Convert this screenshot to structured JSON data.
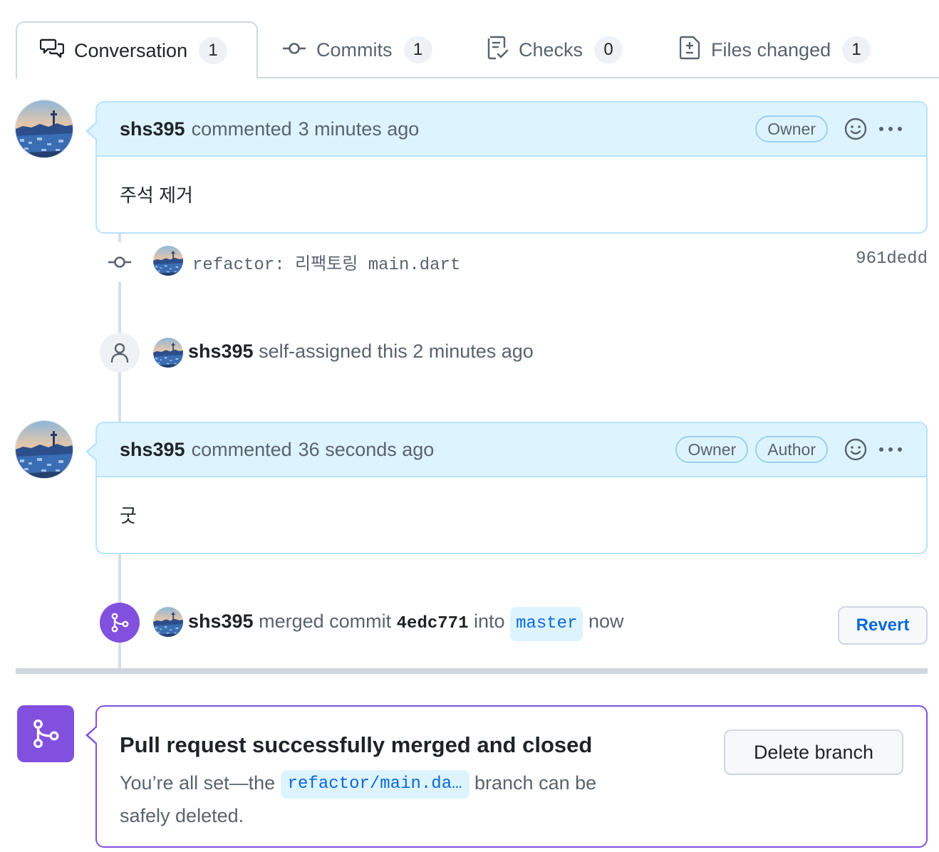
{
  "tabs": [
    {
      "label": "Conversation",
      "count": "1",
      "icon": "conversation-icon",
      "active": true
    },
    {
      "label": "Commits",
      "count": "1",
      "icon": "git-commit-icon",
      "active": false
    },
    {
      "label": "Checks",
      "count": "0",
      "icon": "checklist-icon",
      "active": false
    },
    {
      "label": "Files changed",
      "count": "1",
      "icon": "file-diff-icon",
      "active": false
    }
  ],
  "comments": [
    {
      "author": "shs395",
      "action": "commented",
      "time": "3 minutes ago",
      "roles": [
        "Owner"
      ],
      "body": "주석 제거"
    },
    {
      "author": "shs395",
      "action": "commented",
      "time": "36 seconds ago",
      "roles": [
        "Owner",
        "Author"
      ],
      "body": "굿"
    }
  ],
  "commit_event": {
    "message": "refactor: 리팩토링 main.dart",
    "sha": "961dedd"
  },
  "assign_event": {
    "author": "shs395",
    "text": "self-assigned this 2 minutes ago"
  },
  "merge_event": {
    "author": "shs395",
    "text_before": "merged commit",
    "commit": "4edc771",
    "text_into": "into",
    "branch": "master",
    "time": "now",
    "revert_label": "Revert"
  },
  "merged_box": {
    "title": "Pull request successfully merged and closed",
    "desc_before": "You’re all set—the",
    "branch": "refactor/main.da…",
    "desc_after": "branch can be safely deleted.",
    "delete_label": "Delete branch"
  },
  "colors": {
    "accent": "#0969da",
    "merged": "#8250df",
    "comment_header": "#ddf4ff",
    "comment_border": "#b6e3ff"
  }
}
